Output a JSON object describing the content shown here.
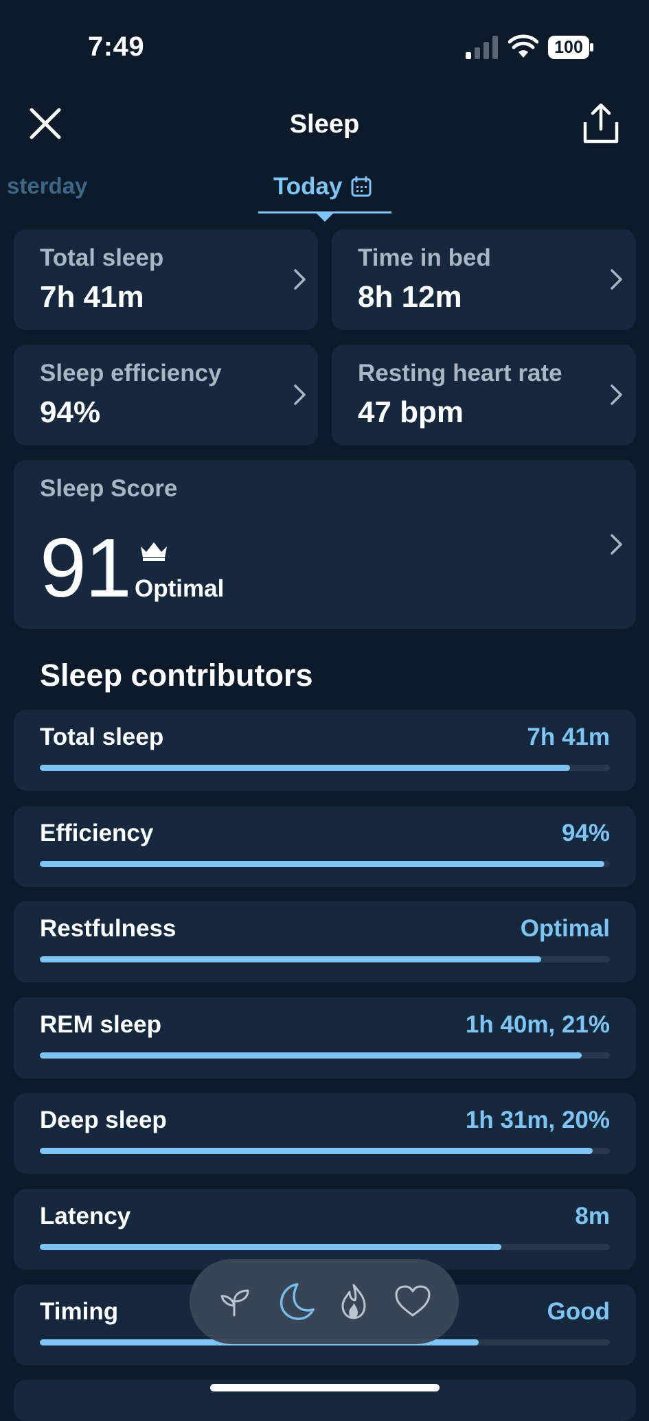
{
  "status_bar": {
    "time": "7:49",
    "battery": "100"
  },
  "header": {
    "title": "Sleep"
  },
  "date_tabs": {
    "previous": "sterday",
    "current": "Today"
  },
  "metrics": [
    {
      "label": "Total sleep",
      "value": "7h 41m"
    },
    {
      "label": "Time in bed",
      "value": "8h 12m"
    },
    {
      "label": "Sleep efficiency",
      "value": "94%"
    },
    {
      "label": "Resting heart rate",
      "value": "47 bpm"
    }
  ],
  "sleep_score": {
    "label": "Sleep Score",
    "value": "91",
    "status": "Optimal"
  },
  "contributors": {
    "title": "Sleep contributors",
    "items": [
      {
        "name": "Total sleep",
        "value": "7h 41m",
        "level": 0.93
      },
      {
        "name": "Efficiency",
        "value": "94%",
        "level": 0.99
      },
      {
        "name": "Restfulness",
        "value": "Optimal",
        "level": 0.88
      },
      {
        "name": "REM sleep",
        "value": "1h 40m, 21%",
        "level": 0.95
      },
      {
        "name": "Deep sleep",
        "value": "1h 31m, 20%",
        "level": 0.97
      },
      {
        "name": "Latency",
        "value": "8m",
        "level": 0.81
      },
      {
        "name": "Timing",
        "value": "Good",
        "level": 0.77
      }
    ]
  },
  "bottom_nav": {
    "items": [
      {
        "icon": "sprout-icon",
        "active": false
      },
      {
        "icon": "moon-icon",
        "active": true
      },
      {
        "icon": "flame-icon",
        "active": false
      },
      {
        "icon": "heart-icon",
        "active": false
      }
    ]
  },
  "colors": {
    "background": "#0d1a29",
    "card": "#16283d",
    "accent": "#7ec4f4",
    "muted_text": "#a9b6c3"
  }
}
